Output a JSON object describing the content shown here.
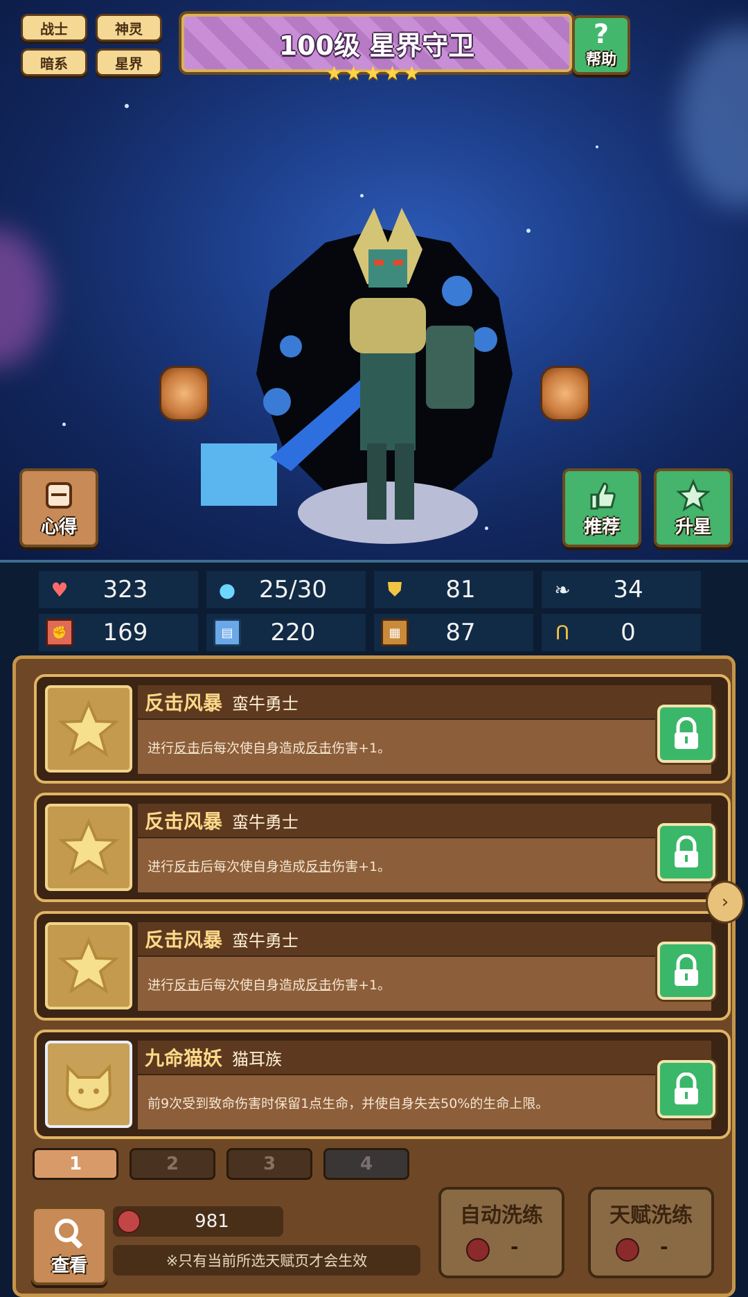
{
  "tags": [
    "战士",
    "神灵",
    "暗系",
    "星界"
  ],
  "title": "100级 星界守卫",
  "stars": 5,
  "help_label": "帮助",
  "side_buttons": {
    "insight_label": "心得",
    "recommend_label": "推荐",
    "upgrade_star_label": "升星"
  },
  "stats": [
    {
      "icon": "heart-icon",
      "value": "323"
    },
    {
      "icon": "mana-drop-icon",
      "value": "25/30"
    },
    {
      "icon": "shield-icon",
      "value": "81"
    },
    {
      "icon": "wing-icon",
      "value": "34"
    },
    {
      "icon": "fist-icon",
      "value": "169"
    },
    {
      "icon": "book-icon",
      "value": "220"
    },
    {
      "icon": "magic-armor-icon",
      "value": "87"
    },
    {
      "icon": "horseshoe-icon",
      "value": "0"
    }
  ],
  "talents": [
    {
      "name": "反击风暴",
      "race": "蛮牛勇士",
      "desc_parts": [
        "进行",
        "反击",
        "后每次使自身造成",
        "反击",
        "伤害+1。"
      ],
      "icon": "star-icon"
    },
    {
      "name": "反击风暴",
      "race": "蛮牛勇士",
      "desc_parts": [
        "进行",
        "反击",
        "后每次使自身造成",
        "反击",
        "伤害+1。"
      ],
      "icon": "star-icon"
    },
    {
      "name": "反击风暴",
      "race": "蛮牛勇士",
      "desc_parts": [
        "进行",
        "反击",
        "后每次使自身造成",
        "反击",
        "伤害+1。"
      ],
      "icon": "star-icon"
    },
    {
      "name": "九命猫妖",
      "race": "猫耳族",
      "desc_parts": [
        "前9次受到致命伤害时保留1点生命，并使自身失去50%的生命上限。"
      ],
      "icon": "cat-icon"
    }
  ],
  "pages": [
    "1",
    "2",
    "3",
    "4"
  ],
  "selected_page": "1",
  "fruit_count": "981",
  "notice": "※只有当前所选天赋页才会生效",
  "view_label": "查看",
  "auto_refine": {
    "label": "自动洗练",
    "value": "-"
  },
  "talent_refine": {
    "label": "天赋洗练",
    "value": "-"
  }
}
